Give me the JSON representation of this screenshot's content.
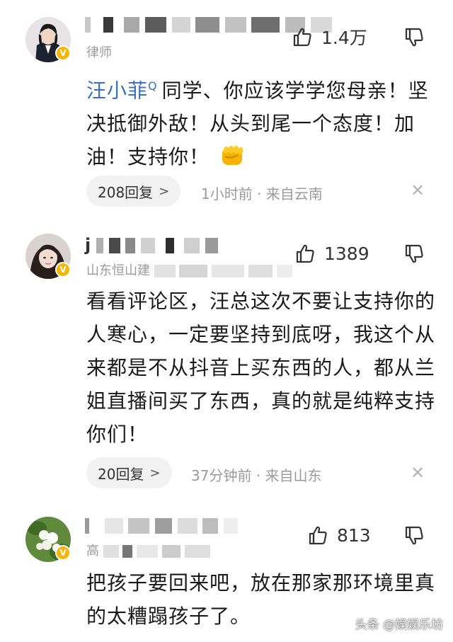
{
  "comments": [
    {
      "username_visible": "",
      "subline": "律师",
      "likes": "1.4万",
      "body_mention": "汪小菲",
      "body_text": "同学、你应该学学您母亲！坚决抵御外敌！从头到尾一个态度！加油！支持你！",
      "reply_count": "208回复",
      "meta": "1小时前 · 来自云南",
      "icons": [
        "thumbs-up-icon",
        "thumbs-down-icon",
        "close-icon",
        "fist-emoji-icon",
        "verified-badge-icon"
      ]
    },
    {
      "username_visible": "j",
      "subline": "山东恒山建",
      "likes": "1389",
      "body_text": "看看评论区，汪总这次不要让支持你的人寒心，一定要坚持到底呀，我这个从来都是不从抖音上买东西的人，都从兰姐直播间买了东西，真的就是纯粹支持你们！",
      "reply_count": "20回复",
      "meta": "37分钟前 · 来自山东"
    },
    {
      "username_visible": "",
      "subline": "高",
      "likes": "813",
      "body_text": "把孩子要回来吧，放在那家那环境里真的太糟蹋孩子了。"
    }
  ],
  "watermark": "头条 @娱娱乐坊",
  "colors": {
    "mention": "#3b6fc1",
    "verified": "#f7b500",
    "muted": "#9a9a9a"
  }
}
